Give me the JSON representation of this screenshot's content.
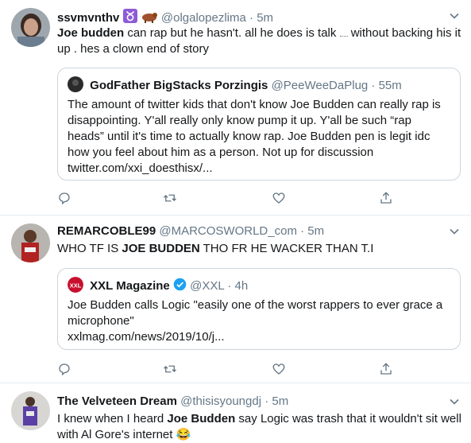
{
  "tweets": [
    {
      "name": "ssvmvnthv",
      "handle": "@olgalopezlima",
      "time": "5m",
      "emoji": [
        "taurus-sign",
        "ox"
      ],
      "body_bold": "Joe budden",
      "body_rest_1": " can rap but he hasn't. all he does is talk ",
      "body_rest_2": " without backing his it up . hes a clown end of story",
      "quote": {
        "name": "GodFather BigStacks Porzingis",
        "handle": "@PeeWeeDaPlug",
        "time": "55m",
        "text": "The amount of twitter kids that don't know Joe Budden can really rap is disappointing. Y'all really only know pump it up. Y'all be such “rap heads” until it's time to actually know rap. Joe Budden pen is legit idc how you feel about him as a person. Not up for discussion",
        "link": "twitter.com/xxi_doesthisx/..."
      }
    },
    {
      "name": "REMARCOBLE99",
      "handle": "@MARCOSWORLD_com",
      "time": "5m",
      "body_pre": "WHO TF IS ",
      "body_bold": "JOE BUDDEN",
      "body_post": " THO FR HE WACKER THAN T.I",
      "quote": {
        "avatar_text": "XXL",
        "name": "XXL Magazine",
        "handle": "@XXL",
        "time": "4h",
        "verified": true,
        "text": "Joe Budden calls Logic \"easily one of the worst rappers to ever grace a microphone\"",
        "link": "xxlmag.com/news/2019/10/j..."
      }
    },
    {
      "name": "The Velveteen Dream",
      "handle": "@thisisyoungdj",
      "time": "5m",
      "body_pre": "I knew when I heard ",
      "body_bold": "Joe Budden",
      "body_post": " say Logic was trash that it wouldn't sit well with Al Gore's internet 😂"
    }
  ],
  "colors": {
    "secondary": "#657786",
    "border": "#ccd6dd",
    "verified": "#1da1f2",
    "xxl_red": "#c8102e",
    "purple": "#8e5bd8"
  },
  "icons": [
    "reply-icon",
    "retweet-icon",
    "like-icon",
    "share-icon",
    "caret-down-icon"
  ]
}
